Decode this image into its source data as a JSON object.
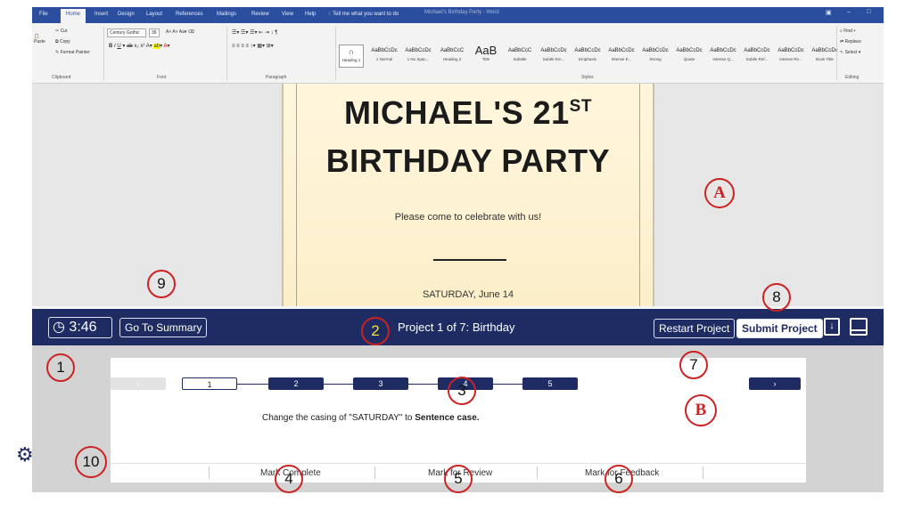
{
  "word": {
    "tabs": [
      "File",
      "Home",
      "Insert",
      "Design",
      "Layout",
      "References",
      "Mailings",
      "Review",
      "View",
      "Help"
    ],
    "active_tab": "Home",
    "tell_me": "Tell me what you want to do",
    "doc_title": "Michael's Birthday Party - Word",
    "clipboard": {
      "paste": "Paste",
      "cut": "Cut",
      "copy": "Copy",
      "format_painter": "Format Painter",
      "group": "Clipboard"
    },
    "font": {
      "name": "Century Gothic",
      "size": "36",
      "group": "Font"
    },
    "paragraph": {
      "group": "Paragraph"
    },
    "styles": {
      "group": "Styles",
      "items": [
        {
          "preview": "AaBbCcDc",
          "name": "1 Normal"
        },
        {
          "preview": "AaBbCcDc",
          "name": "1 No Spac..."
        },
        {
          "preview": "AaBbCcC",
          "name": "Heading 2"
        },
        {
          "preview": "AaB",
          "name": "Title"
        },
        {
          "preview": "AaBbCcC",
          "name": "Subtitle"
        },
        {
          "preview": "AaBbCcDc",
          "name": "Subtle Em..."
        },
        {
          "preview": "AaBbCcDc",
          "name": "Emphasis"
        },
        {
          "preview": "AaBbCcDc",
          "name": "Intense E..."
        },
        {
          "preview": "AaBbCcDc",
          "name": "Strong"
        },
        {
          "preview": "AaBbCcDc",
          "name": "Quote"
        },
        {
          "preview": "AaBbCcDc",
          "name": "Intense Q..."
        },
        {
          "preview": "AaBbCcDc",
          "name": "Subtle Ref..."
        },
        {
          "preview": "AaBbCcDc",
          "name": "Intense Re..."
        },
        {
          "preview": "AaBbCcDc",
          "name": "Book Title"
        }
      ],
      "heading1": "Heading 1"
    },
    "editing": {
      "find": "Find",
      "replace": "Replace",
      "select": "Select",
      "group": "Editing"
    }
  },
  "document": {
    "title_line1": "MICHAEL'S 21",
    "title_sup": "ST",
    "title_line2": "BIRTHDAY PARTY",
    "invite": "Please come to celebrate with us!",
    "date": "SATURDAY, June 14"
  },
  "exam": {
    "timer": "3:46",
    "go_to_summary": "Go To Summary",
    "project": "Project 1 of 7: Birthday",
    "restart": "Restart Project",
    "submit": "Submit Project",
    "steps": [
      "1",
      "2",
      "3",
      "4",
      "5"
    ],
    "current_step": "1",
    "prev": "‹",
    "next": "›",
    "task_prefix": "Change the casing of \"SATURDAY\" to ",
    "task_bold": "Sentence case.",
    "actions": [
      "Mark Complete",
      "Mark for Review",
      "Mark for Feedback"
    ]
  },
  "callouts": [
    "1",
    "2",
    "3",
    "4",
    "5",
    "6",
    "7",
    "8",
    "9",
    "10",
    "A",
    "B"
  ],
  "colors": {
    "exam_bar": "#1f2b63",
    "ribbon_blue": "#2b4f9e",
    "callout_red": "#cc2222"
  }
}
